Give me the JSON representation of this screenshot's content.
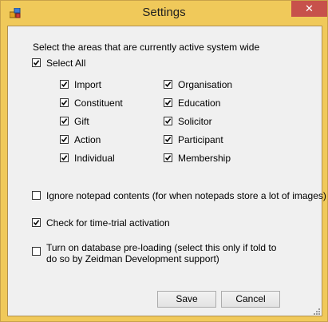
{
  "window": {
    "title": "Settings",
    "close_label": "✕"
  },
  "areas": {
    "heading": "Select the areas that are currently active system wide",
    "select_all": {
      "label": "Select All",
      "checked": true
    },
    "left": [
      {
        "label": "Import",
        "checked": true
      },
      {
        "label": "Constituent",
        "checked": true
      },
      {
        "label": "Gift",
        "checked": true
      },
      {
        "label": "Action",
        "checked": true
      },
      {
        "label": "Individual",
        "checked": true
      }
    ],
    "right": [
      {
        "label": "Organisation",
        "checked": true
      },
      {
        "label": "Education",
        "checked": true
      },
      {
        "label": "Solicitor",
        "checked": true
      },
      {
        "label": "Participant",
        "checked": true
      },
      {
        "label": "Membership",
        "checked": true
      }
    ]
  },
  "options": {
    "ignore_notepad": {
      "label": "Ignore notepad contents (for when notepads store a lot of images)",
      "checked": false
    },
    "time_trial": {
      "label": "Check for time-trial activation",
      "checked": true
    },
    "preloading": {
      "line1": "Turn on database pre-loading (select this only if told to",
      "line2": "do so by Zeidman Development support)",
      "checked": false
    }
  },
  "buttons": {
    "save": "Save",
    "cancel": "Cancel"
  }
}
